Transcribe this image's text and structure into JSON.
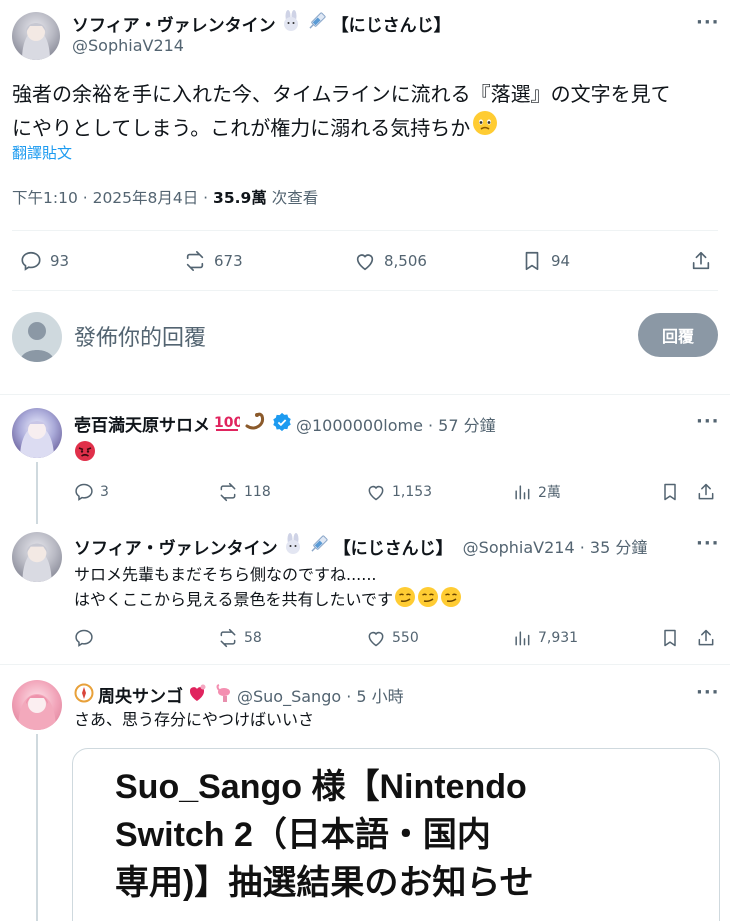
{
  "main_tweet": {
    "name": "ソフィア・ヴァレンタイン",
    "badge_text": "【にじさんじ】",
    "handle": "@SophiaV214",
    "text_line1": "強者の余裕を手に入れた今、タイムラインに流れる『落選』の文字を見て",
    "text_line2": "にやりとしてしまう。これが権力に溺れる気持ちか",
    "emoji": "face-holding-back-tears-emoji",
    "translate": "翻譯貼文",
    "time": "下午1:10 · 2025年8月4日 · ",
    "views": "35.9萬",
    "views_label": " 次查看",
    "stats": {
      "replies": "93",
      "retweets": "673",
      "likes": "8,506",
      "bookmarks": "94"
    }
  },
  "compose": {
    "placeholder": "發佈你的回覆",
    "button": "回覆"
  },
  "replies": [
    {
      "name": "壱百満天原サロメ",
      "handle": "@1000000lome · 57 分鐘",
      "text": "",
      "stats": {
        "replies": "3",
        "retweets": "118",
        "likes": "1,153",
        "views": "2萬"
      }
    },
    {
      "name": "ソフィア・ヴァレンタイン",
      "badge_text": "【にじさんじ】",
      "handle": "@SophiaV214 · 35 分鐘",
      "text_line1": "サロメ先輩もまだそちら側なのですね......",
      "text_line2": "はやくここから見える景色を共有したいです",
      "stats": {
        "replies": "",
        "retweets": "58",
        "likes": "550",
        "views": "7,931"
      }
    },
    {
      "name": "周央サンゴ",
      "handle": "@Suo_Sango · 5 小時",
      "text": "さあ、思う存分にやつけばいいさ",
      "card_line1": "Suo_Sango 様【Nintendo",
      "card_line2": "Switch 2（日本語・国内",
      "card_line3": "専用)】抽選結果のお知らせ"
    }
  ],
  "colors": {
    "link": "#1d9bf0",
    "muted": "#536471",
    "verified": "#1d9bf0",
    "button": "#8b98a5"
  }
}
